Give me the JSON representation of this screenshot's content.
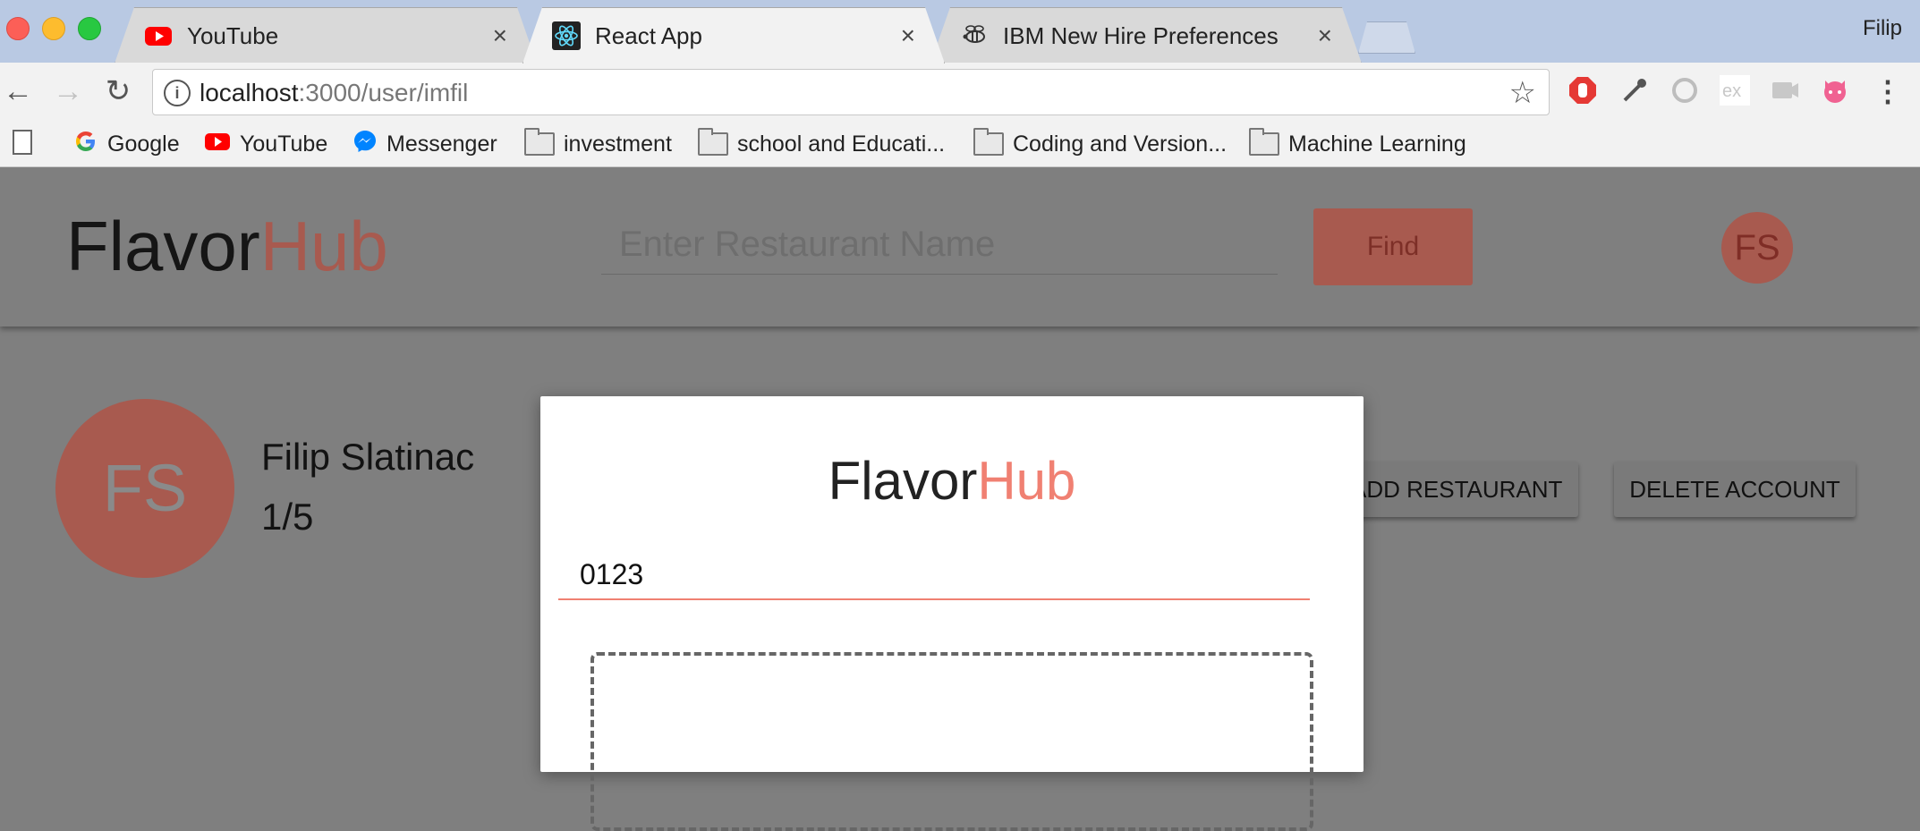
{
  "browser": {
    "tabs": [
      {
        "title": "YouTube",
        "icon": "youtube-icon",
        "active": false
      },
      {
        "title": "React App",
        "icon": "react-icon",
        "active": true
      },
      {
        "title": "IBM New Hire Preferences",
        "icon": "bee-icon",
        "active": false
      }
    ],
    "close_glyph": "×",
    "profile_name": "Filip",
    "url_host": "localhost",
    "url_rest": ":3000/user/imfil",
    "bookmarks": [
      {
        "label": "Google",
        "icon": "google-icon"
      },
      {
        "label": "YouTube",
        "icon": "youtube-icon"
      },
      {
        "label": "Messenger",
        "icon": "messenger-icon"
      },
      {
        "label": "investment",
        "icon": "folder-icon"
      },
      {
        "label": "school and Educati...",
        "icon": "folder-icon"
      },
      {
        "label": "Coding and Version...",
        "icon": "folder-icon"
      },
      {
        "label": "Machine Learning",
        "icon": "folder-icon"
      }
    ]
  },
  "app": {
    "brand_left": "Flavor",
    "brand_right": "Hub",
    "search_placeholder": "Enter Restaurant Name",
    "find_label": "Find",
    "header_avatar_initials": "FS",
    "colors": {
      "accent": "#f08072",
      "accent_dimmed": "#a85a4f",
      "overlay": "#7f7f7f"
    }
  },
  "profile": {
    "initials": "FS",
    "name": "Filip Slatinac",
    "rating": "1/5",
    "add_restaurant_label": "ADD RESTAURANT",
    "delete_account_label": "DELETE ACCOUNT"
  },
  "modal": {
    "brand_left": "Flavor",
    "brand_right": "Hub",
    "input_value": "0123"
  }
}
